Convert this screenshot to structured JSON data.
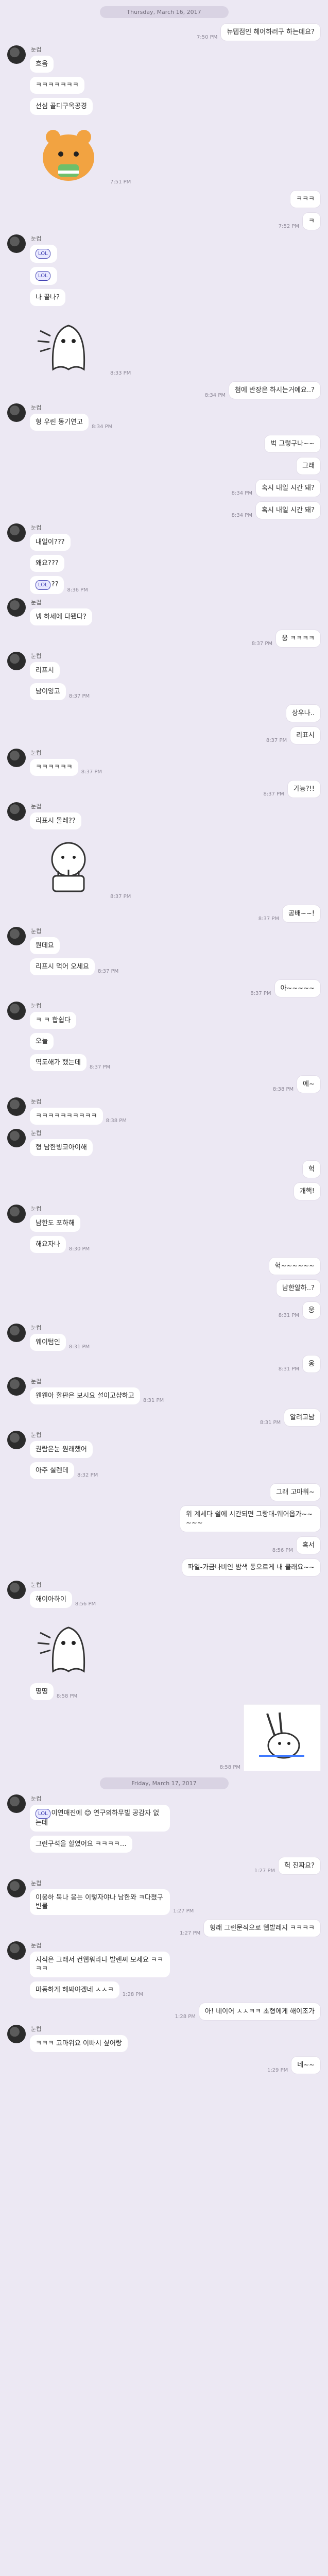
{
  "dates": {
    "first": "Thursday, March 16, 2017",
    "second": "Friday, March 17, 2017"
  },
  "sender_name": "눈컵",
  "messages": [
    {
      "id": "m1",
      "side": "mine",
      "text": "뉴텝점인 헤어하러구 하는데요?",
      "time": "7:50 PM"
    },
    {
      "id": "m2",
      "side": "theirs",
      "show_name": true,
      "text": "흐음",
      "time": ""
    },
    {
      "id": "m3",
      "side": "theirs",
      "text": "ㅋㅋㅋㅋㅋㅋㅋ",
      "time": ""
    },
    {
      "id": "m4",
      "side": "theirs",
      "text": "선심 골디구옥공경",
      "time": ""
    },
    {
      "id": "m5",
      "side": "theirs",
      "sticker": "bear",
      "time": "7:51 PM"
    },
    {
      "id": "m6",
      "side": "mine",
      "text": "ㅋㅋㅋ",
      "time": ""
    },
    {
      "id": "m7",
      "side": "mine",
      "text": "ㅋ",
      "time": "7:52 PM"
    },
    {
      "id": "m8",
      "side": "theirs",
      "show_name": true,
      "tag": "LOL",
      "text": "",
      "time": ""
    },
    {
      "id": "m9",
      "side": "theirs",
      "tag": "LOL",
      "text": "",
      "time": ""
    },
    {
      "id": "m10",
      "side": "theirs",
      "text": "나 끝나?",
      "time": ""
    },
    {
      "id": "m11",
      "side": "theirs",
      "sticker": "ghost",
      "time": "8:33 PM"
    },
    {
      "id": "m12",
      "side": "mine",
      "text": "첨에 반장은 하시는거예요..?",
      "time": "8:34 PM"
    },
    {
      "id": "m13",
      "side": "theirs",
      "show_name": true,
      "text": "형 우린 동기연고",
      "time": "8:34 PM"
    },
    {
      "id": "m14",
      "side": "mine",
      "text": "벅 그렇구나~~",
      "time": ""
    },
    {
      "id": "m15",
      "side": "mine",
      "text": "그래",
      "time": ""
    },
    {
      "id": "m16",
      "side": "mine",
      "text": "혹시 내일 시간 돼?",
      "time": "8:34 PM"
    },
    {
      "id": "m17",
      "side": "mine",
      "text": "혹시 내일 시간 돼?",
      "time": "8:34 PM"
    },
    {
      "id": "m18",
      "side": "theirs",
      "show_name": true,
      "text": "내일이???",
      "time": ""
    },
    {
      "id": "m19",
      "side": "theirs",
      "text": "왜요???",
      "time": ""
    },
    {
      "id": "m20",
      "side": "theirs",
      "tag": "LOL",
      "text": "??",
      "time": "8:36 PM"
    },
    {
      "id": "m21",
      "side": "theirs",
      "show_name": true,
      "text": "넹 하세에 다됐다?",
      "time": ""
    },
    {
      "id": "m22",
      "side": "mine",
      "text": "웅 ㅋㅋㅋㅋ",
      "time": "8:37 PM"
    },
    {
      "id": "m23",
      "side": "theirs",
      "show_name": true,
      "text": "리프시",
      "time": ""
    },
    {
      "id": "m24",
      "side": "theirs",
      "text": "남이잉고",
      "time": "8:37 PM"
    },
    {
      "id": "m25",
      "side": "mine",
      "text": "상우나..",
      "time": ""
    },
    {
      "id": "m26",
      "side": "mine",
      "text": "리표시",
      "time": "8:37 PM"
    },
    {
      "id": "m27",
      "side": "theirs",
      "show_name": true,
      "text": "ㅋㅋㅋㅋㅋㅋ",
      "time": "8:37 PM"
    },
    {
      "id": "m28",
      "side": "mine",
      "text": "가능?!!",
      "time": "8:37 PM"
    },
    {
      "id": "m29",
      "side": "theirs",
      "show_name": true,
      "text": "리표시 몰레??",
      "time": ""
    },
    {
      "id": "m30",
      "side": "theirs",
      "sticker": "cake",
      "time": "8:37 PM"
    },
    {
      "id": "m31",
      "side": "mine",
      "text": "공배~~!",
      "time": "8:37 PM"
    },
    {
      "id": "m32",
      "side": "theirs",
      "show_name": true,
      "text": "뭔데요",
      "time": ""
    },
    {
      "id": "m33",
      "side": "theirs",
      "text": "리프시 먹어 오세요",
      "time": "8:37 PM"
    },
    {
      "id": "m34",
      "side": "mine",
      "text": "아~~~~~",
      "time": "8:37 PM"
    },
    {
      "id": "m35",
      "side": "theirs",
      "show_name": true,
      "text": "ㅋ ㅋ 합쉽다",
      "time": ""
    },
    {
      "id": "m36",
      "side": "theirs",
      "text": "오늘",
      "time": ""
    },
    {
      "id": "m37",
      "side": "theirs",
      "text": "역도해가 했는데",
      "time": "8:37 PM"
    },
    {
      "id": "m38",
      "side": "mine",
      "text": "에~",
      "time": "8:38 PM"
    },
    {
      "id": "m39",
      "side": "theirs",
      "show_name": true,
      "text": "ㅋㅋㅋㅋㅋㅋㅋㅋㅋㅋ",
      "time": "8:38 PM"
    },
    {
      "id": "m40",
      "side": "theirs",
      "show_name": true,
      "text": "형 남한빙코아이해",
      "time": ""
    },
    {
      "id": "m41",
      "side": "mine",
      "text": "헉",
      "time": ""
    },
    {
      "id": "m42",
      "side": "mine",
      "text": "개핵!",
      "time": ""
    },
    {
      "id": "m43",
      "side": "theirs",
      "show_name": true,
      "text": "남한도 포하해",
      "time": ""
    },
    {
      "id": "m44",
      "side": "theirs",
      "text": "해요자나",
      "time": "8:30 PM"
    },
    {
      "id": "m45",
      "side": "mine",
      "text": "헉~~~~~~",
      "time": ""
    },
    {
      "id": "m46",
      "side": "mine",
      "text": "남한알하..?",
      "time": ""
    },
    {
      "id": "m47",
      "side": "mine",
      "text": "웅",
      "time": "8:31 PM"
    },
    {
      "id": "m48",
      "side": "theirs",
      "show_name": true,
      "text": "웨이텀인",
      "time": "8:31 PM"
    },
    {
      "id": "m49",
      "side": "mine",
      "text": "웅",
      "time": "8:31 PM"
    },
    {
      "id": "m50",
      "side": "theirs",
      "show_name": true,
      "text": "웬웬아 할판은 보시요 설이고샵하고",
      "time": "8:31 PM"
    },
    {
      "id": "m51",
      "side": "mine",
      "text": "알려고남",
      "time": "8:31 PM"
    },
    {
      "id": "m52",
      "side": "theirs",
      "show_name": true,
      "text": "권람은눈 원래했어",
      "time": ""
    },
    {
      "id": "m53",
      "side": "theirs",
      "text": "아주 설렌데",
      "time": "8:32 PM"
    },
    {
      "id": "m54",
      "side": "mine",
      "text": "그래 고마워~",
      "time": ""
    },
    {
      "id": "m55",
      "side": "mine",
      "text": "위 계세다 쉴에 시간되면 그랑대-웨어옵가~~~~~",
      "time": ""
    },
    {
      "id": "m56",
      "side": "mine",
      "text": "혹서",
      "time": "8:56 PM"
    },
    {
      "id": "m57",
      "side": "mine",
      "text": "파일-가금나비인 밤색 동으르게 내 클래요~~",
      "time": ""
    },
    {
      "id": "m58",
      "side": "theirs",
      "show_name": true,
      "text": "해이아하이",
      "time": "8:56 PM"
    },
    {
      "id": "m59",
      "side": "theirs",
      "sticker": "ghost2",
      "time": ""
    },
    {
      "id": "m60",
      "side": "theirs",
      "text": "띵띵",
      "time": "8:58 PM"
    },
    {
      "id": "m61",
      "side": "mine",
      "sticker": "bunny",
      "time": "8:58 PM"
    },
    {
      "id": "m62",
      "side": "theirs",
      "show_name": true,
      "tag": "LOL",
      "text": "이연매진에 😊 연구외하무빌 공감자 없는데",
      "time": ""
    },
    {
      "id": "m63",
      "side": "theirs",
      "text": "그런구석을 할였어요 ㅋㅋㅋㅋ…",
      "time": ""
    },
    {
      "id": "m64",
      "side": "mine",
      "text": "헉 진짜요?",
      "time": "1:27 PM"
    },
    {
      "id": "m65",
      "side": "theirs",
      "show_name": true,
      "text": "이웅하 묵나 응는 이렇자야나 남한와 ㅋ다쳤구빈물",
      "time": "1:27 PM"
    },
    {
      "id": "m66",
      "side": "mine",
      "text": "형래 그런문직으로 웹발레지 ㅋㅋㅋㅋ",
      "time": "1:27 PM"
    },
    {
      "id": "m67",
      "side": "theirs",
      "show_name": true,
      "text": "지적은 그래서 컨웹워라나 발렌씨 모세요 ㅋㅋㅋㅋ",
      "time": ""
    },
    {
      "id": "m68",
      "side": "theirs",
      "text": "마동하게 해봐야겠네 ㅅㅅㅋ",
      "time": "1:28 PM"
    },
    {
      "id": "m69",
      "side": "mine",
      "text": "아! 네이어 ㅅㅅㅋㅋ 초형에게 해이조가",
      "time": "1:28 PM"
    },
    {
      "id": "m70",
      "side": "theirs",
      "show_name": true,
      "text": "ㅋㅋㅋ 고마위요 이빠시 싶어랑",
      "time": ""
    },
    {
      "id": "m71",
      "side": "mine",
      "text": "네~~",
      "time": "1:29 PM"
    }
  ]
}
